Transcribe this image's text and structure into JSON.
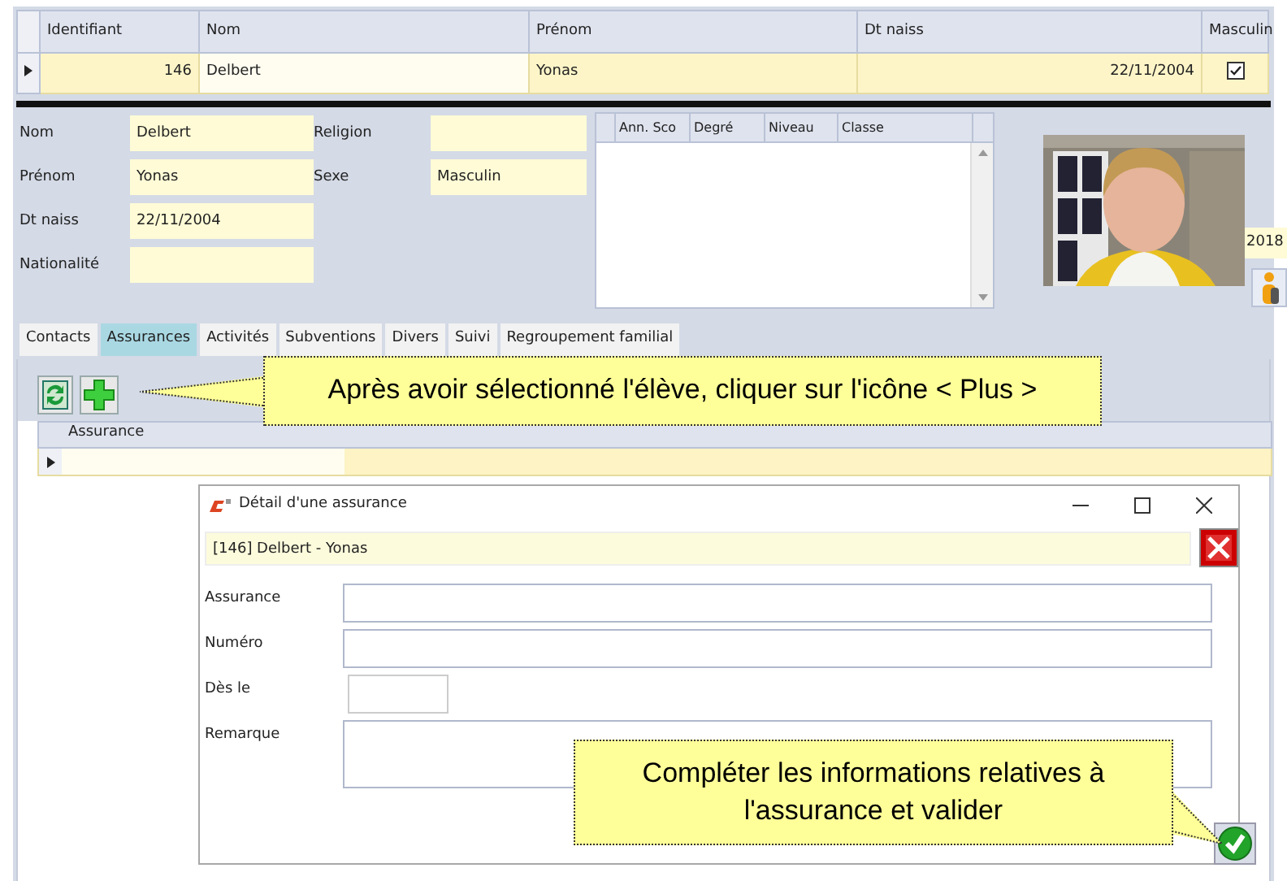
{
  "student_grid": {
    "columns": [
      "Identifiant",
      "Nom",
      "Prénom",
      "Dt naiss",
      "Masculin"
    ],
    "rows": [
      {
        "selected": true,
        "identifiant": "146",
        "nom": "Delbert",
        "prenom": "Yonas",
        "dt_naiss": "22/11/2004",
        "masculin": true
      }
    ]
  },
  "student_form": {
    "rows": [
      [
        {
          "label": "Nom",
          "value": "Delbert"
        },
        {
          "label": "Religion"
        }
      ],
      [
        {
          "label": "Prénom",
          "value": "Yonas"
        },
        {
          "label": "Sexe",
          "value": "Masculin"
        }
      ],
      [
        {
          "label": "Dt naiss",
          "value": "22/11/2004"
        }
      ],
      [
        {
          "label": "Nationalité"
        }
      ]
    ]
  },
  "school_grid": {
    "columns": [
      "Ann. Sco",
      "Degré",
      "Niveau",
      "Classe"
    ]
  },
  "side_fragment": {
    "text": "2018"
  },
  "tabs": [
    {
      "label": "Contacts",
      "selected": false
    },
    {
      "label": "Assurances",
      "selected": true
    },
    {
      "label": "Activités",
      "selected": false
    },
    {
      "label": "Subventions",
      "selected": false
    },
    {
      "label": "Divers",
      "selected": false
    },
    {
      "label": "Suivi",
      "selected": false
    },
    {
      "label": "Regroupement familial",
      "selected": false
    }
  ],
  "insurance_grid": {
    "columns": [
      "Assurance"
    ],
    "rows": [
      {
        "selected": true
      }
    ]
  },
  "dialog": {
    "title": "Détail d'une assurance",
    "header": "[146] Delbert - Yonas",
    "fields": [
      {
        "label": "Assurance",
        "kind": "text"
      },
      {
        "label": "Numéro",
        "kind": "text"
      },
      {
        "label": "Dès le",
        "kind": "short"
      },
      {
        "label": "Remarque",
        "kind": "multiline"
      }
    ]
  },
  "callouts": [
    {
      "text": "Après avoir sélectionné l'élève, cliquer sur l'icône < Plus >"
    },
    {
      "text": "Compléter les informations relatives à l'assurance et valider"
    }
  ]
}
